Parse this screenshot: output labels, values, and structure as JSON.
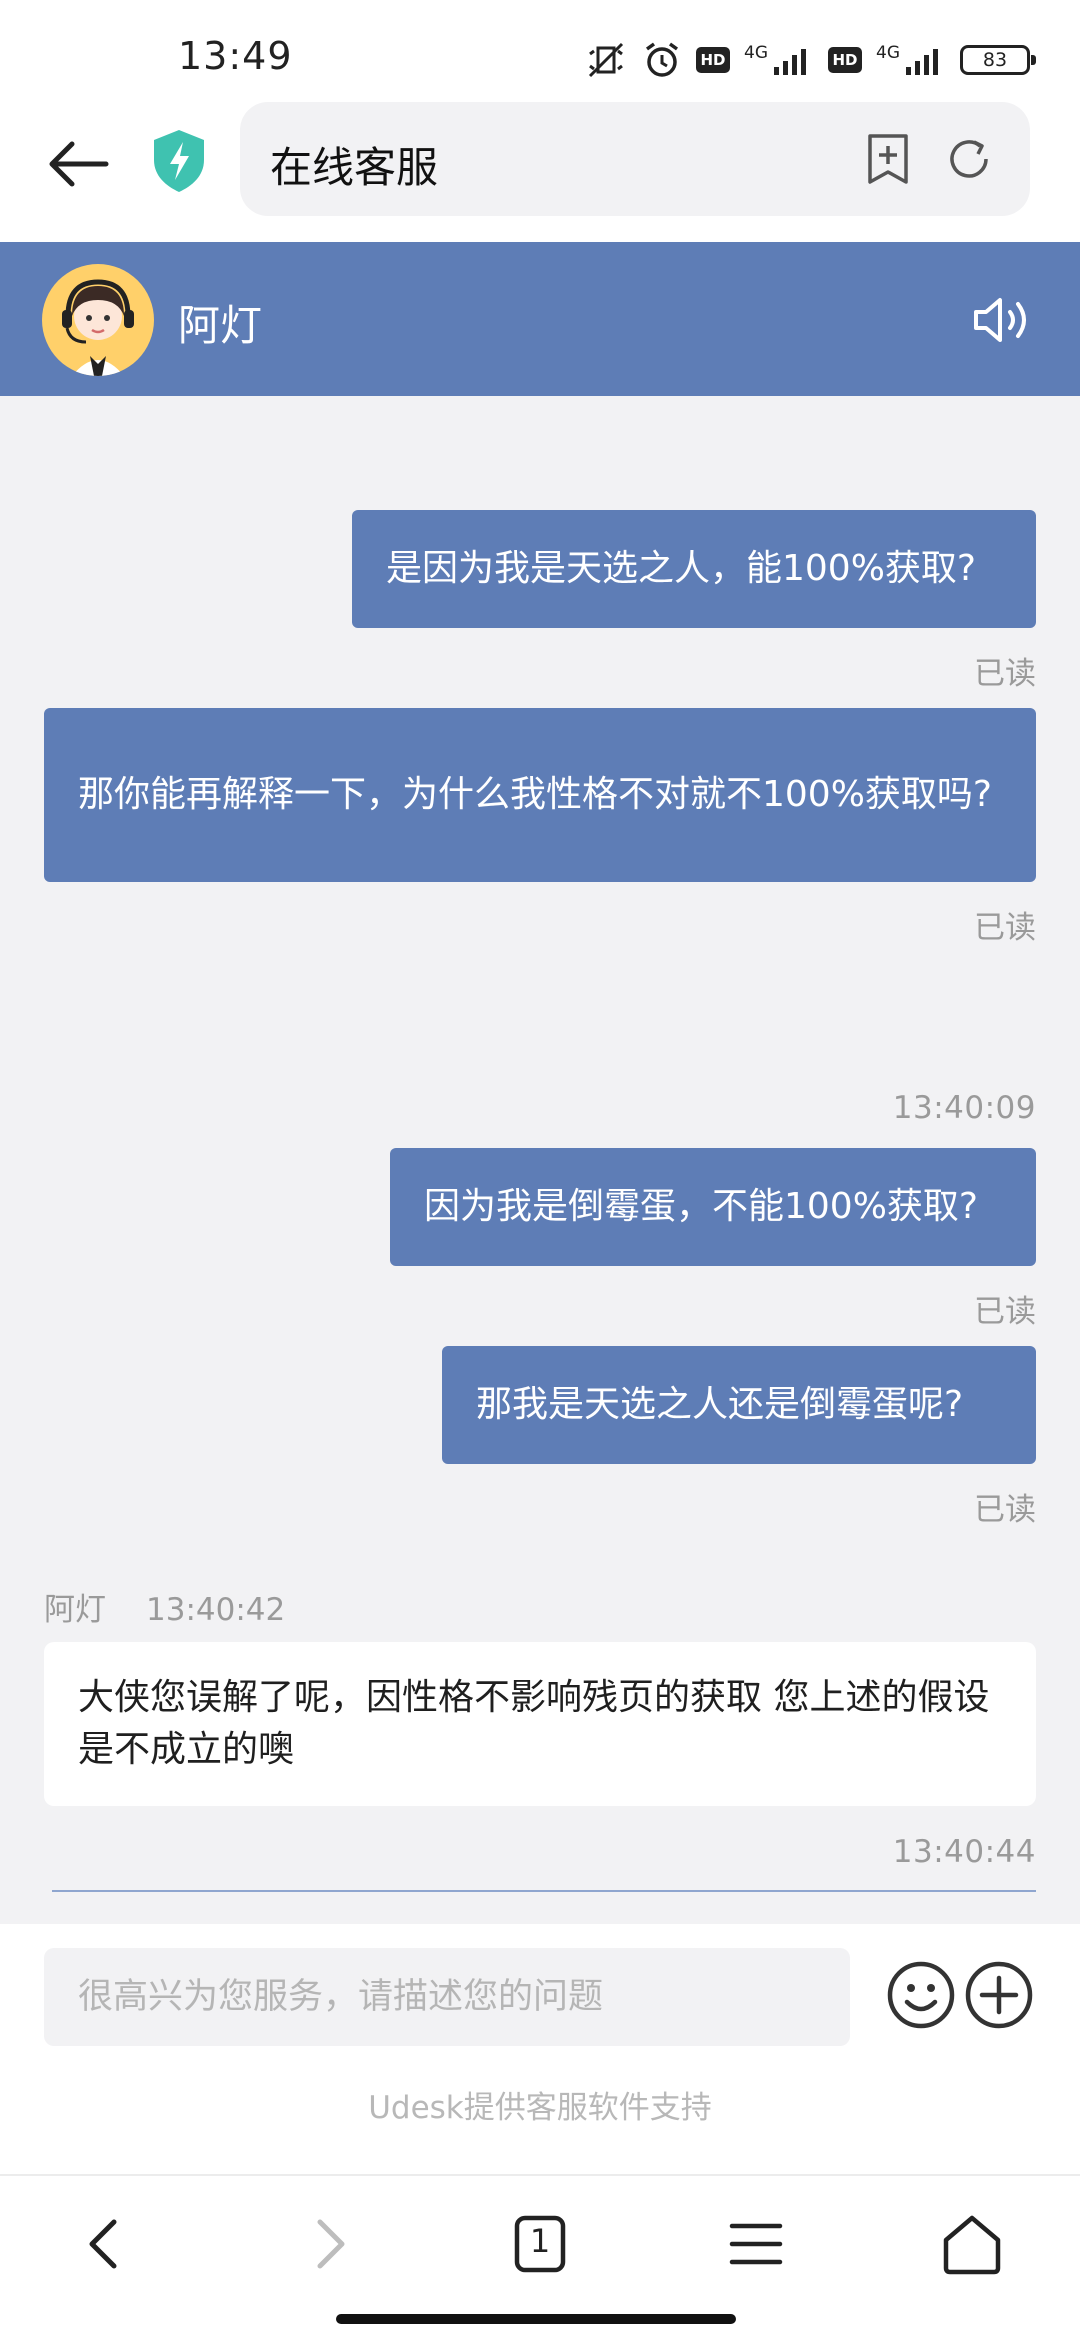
{
  "status_bar": {
    "time": "13:49",
    "network_1": "4G",
    "network_2": "4G",
    "hd_1": "HD",
    "hd_2": "HD",
    "battery": "83"
  },
  "browser": {
    "title": "在线客服",
    "icons": [
      "back-arrow-icon",
      "shield-lightning-icon",
      "bookmark-add-icon",
      "refresh-icon"
    ]
  },
  "chat_header": {
    "agent_name": "阿灯",
    "background_color": "#5e7db6"
  },
  "messages": [
    {
      "type": "outgoing",
      "text": "是因为我是天选之人，能100%获取?",
      "status": "已读"
    },
    {
      "type": "outgoing",
      "text": "那你能再解释一下，为什么我性格不对就不100%获取吗?",
      "status": "已读"
    },
    {
      "type": "timestamp",
      "text": "13:40:09"
    },
    {
      "type": "outgoing",
      "text": "因为我是倒霉蛋，不能100%获取?",
      "status": "已读"
    },
    {
      "type": "outgoing",
      "text": "那我是天选之人还是倒霉蛋呢?",
      "status": "已读"
    },
    {
      "type": "incoming",
      "sender": "阿灯",
      "time": "13:40:42",
      "text": "大侠您误解了呢，因性格不影响残页的获取 您上述的假设是不成立的噢"
    },
    {
      "type": "timestamp",
      "text": "13:40:44"
    }
  ],
  "input": {
    "placeholder": "很高兴为您服务，请描述您的问题",
    "value": ""
  },
  "powered_by": "Udesk提供客服软件支持",
  "bottom_nav": {
    "tab_count": "1",
    "icons": [
      "back-icon",
      "forward-icon",
      "tabs-icon",
      "menu-icon",
      "home-icon"
    ]
  }
}
